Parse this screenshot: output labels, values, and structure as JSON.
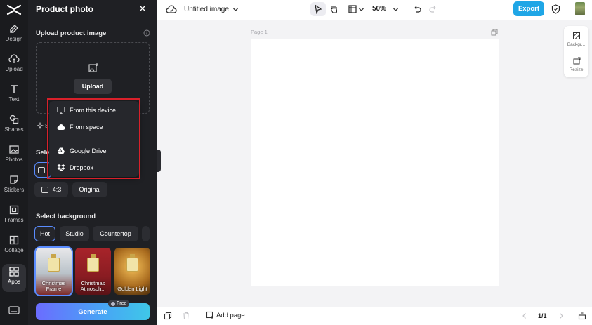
{
  "rail": {
    "items": [
      {
        "label": "Design",
        "icon": "design-icon"
      },
      {
        "label": "Upload",
        "icon": "upload-icon"
      },
      {
        "label": "Text",
        "icon": "text-icon"
      },
      {
        "label": "Shapes",
        "icon": "shapes-icon"
      },
      {
        "label": "Photos",
        "icon": "photos-icon"
      },
      {
        "label": "Stickers",
        "icon": "stickers-icon"
      },
      {
        "label": "Frames",
        "icon": "frames-icon"
      },
      {
        "label": "Collage",
        "icon": "collage-icon"
      },
      {
        "label": "Apps",
        "icon": "apps-icon"
      }
    ]
  },
  "panel": {
    "title": "Product photo",
    "upload_section_title": "Upload product image",
    "upload_label": "Upload",
    "s_fragment": "S",
    "ratio_section_fragment": "Sele",
    "ratios": [
      "4:3",
      "Original"
    ],
    "background_section_title": "Select background",
    "bg_tabs": [
      "Hot",
      "Studio",
      "Countertop"
    ],
    "thumbs": [
      {
        "label": "Christmas Frame"
      },
      {
        "label": "Christmas Atmosph..."
      },
      {
        "label": "Golden Light"
      }
    ],
    "generate_label": "Generate",
    "free_badge": "Free"
  },
  "menu": {
    "items": [
      {
        "label": "From this device",
        "icon": "monitor-icon"
      },
      {
        "label": "From space",
        "icon": "cloud-icon"
      },
      {
        "label": "Google Drive",
        "icon": "google-drive-icon"
      },
      {
        "label": "Dropbox",
        "icon": "dropbox-icon"
      }
    ]
  },
  "topbar": {
    "doc_title": "Untitled image",
    "zoom": "50%",
    "export_label": "Export"
  },
  "canvas": {
    "page_label": "Page 1"
  },
  "rightbar": {
    "items": [
      {
        "label": "Backgr..."
      },
      {
        "label": "Resize"
      }
    ]
  },
  "bottombar": {
    "add_page_label": "Add page",
    "page_count": "1/1"
  },
  "colors": {
    "accent": "#1fa6e6",
    "highlight_frame": "#d8202a",
    "selection": "#5a8cff"
  }
}
